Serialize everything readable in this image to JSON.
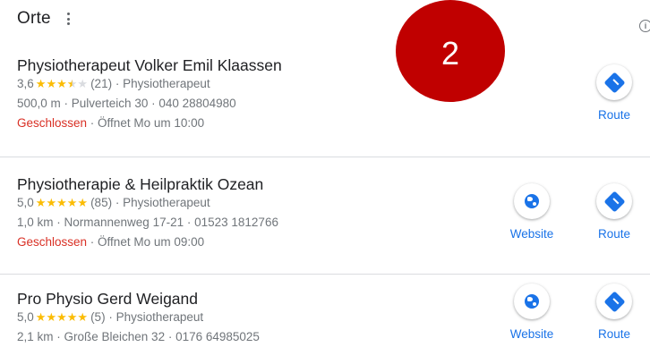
{
  "header": {
    "title": "Orte",
    "badge_number": "2"
  },
  "places": [
    {
      "name": "Physiotherapeut Volker Emil Klaassen",
      "rating_value": "3,6",
      "rating_stars": 3.5,
      "review_count": "(21)",
      "category": "Physiotherapeut",
      "distance": "500,0 m",
      "address": "Pulverteich 30",
      "phone": "040 28804980",
      "status": "Geschlossen",
      "opens": "Öffnet Mo um 10:00",
      "website_label": null,
      "route_label": "Route"
    },
    {
      "name": "Physiotherapie & Heilpraktik Ozean",
      "rating_value": "5,0",
      "rating_stars": 5,
      "review_count": "(85)",
      "category": "Physiotherapeut",
      "distance": "1,0 km",
      "address": "Normannenweg 17-21",
      "phone": "01523 1812766",
      "status": "Geschlossen",
      "opens": "Öffnet Mo um 09:00",
      "website_label": "Website",
      "route_label": "Route"
    },
    {
      "name": "Pro Physio Gerd Weigand",
      "rating_value": "5,0",
      "rating_stars": 5,
      "review_count": "(5)",
      "category": "Physiotherapeut",
      "distance": "2,1 km",
      "address": "Große Bleichen 32",
      "phone": "0176 64985025",
      "status": null,
      "opens": null,
      "website_label": "Website",
      "route_label": "Route"
    }
  ],
  "separator": " · ",
  "icons": {
    "menu": "more-vert-icon",
    "info": "info-icon",
    "route": "directions-icon",
    "website": "globe-icon"
  },
  "colors": {
    "star": "#fbbc04",
    "closed": "#d93025",
    "link": "#1a73e8",
    "badge": "#c00000"
  }
}
